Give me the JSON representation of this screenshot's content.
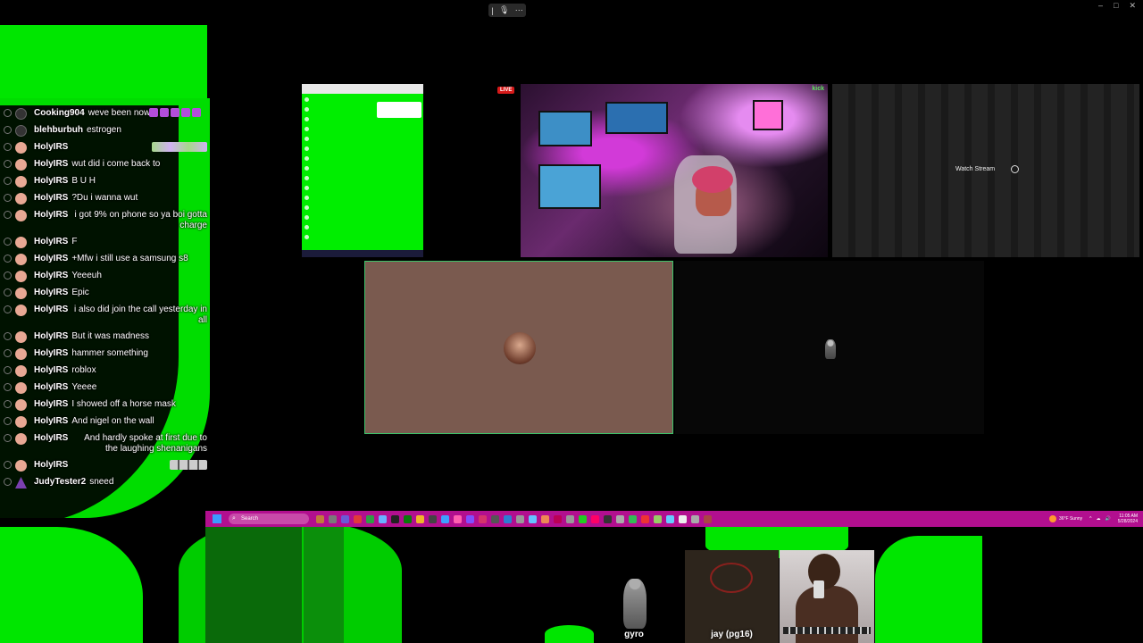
{
  "chat": {
    "messages": [
      {
        "user": "Cooking904",
        "text": "weve been now",
        "avatar": "dark"
      },
      {
        "user": "blehburbuh",
        "text": "estrogen",
        "avatar": "dark"
      },
      {
        "user": "HolyIRS",
        "text": "",
        "emote": true
      },
      {
        "user": "HolyIRS",
        "text": "wut did i come back to"
      },
      {
        "user": "HolyIRS",
        "text": "B U H"
      },
      {
        "user": "HolyIRS",
        "text": "?Du i wanna wut"
      },
      {
        "user": "HolyIRS",
        "text": "i got 9% on phone so ya boi gotta charge"
      },
      {
        "user": "HolyIRS",
        "text": "F"
      },
      {
        "user": "HolyIRS",
        "text": "+Mfw i still use a samsung s8"
      },
      {
        "user": "HolyIRS",
        "text": "Yeeeuh"
      },
      {
        "user": "HolyIRS",
        "text": "Epic"
      },
      {
        "user": "HolyIRS",
        "text": "i also did join the call yesterday in all"
      },
      {
        "user": "HolyIRS",
        "text": "But it was madness"
      },
      {
        "user": "HolyIRS",
        "text": "hammer something"
      },
      {
        "user": "HolyIRS",
        "text": "roblox"
      },
      {
        "user": "HolyIRS",
        "text": "Yeeee"
      },
      {
        "user": "HolyIRS",
        "text": "I showed off a horse mask"
      },
      {
        "user": "HolyIRS",
        "text": "And nigel on the wall"
      },
      {
        "user": "HolyIRS",
        "text": "And hardly spoke at first due to the laughing shenanigans"
      },
      {
        "user": "HolyIRS",
        "text": "",
        "emote_small": true
      },
      {
        "user": "JudyTester2",
        "text": "sneed",
        "avatar": "purple"
      }
    ]
  },
  "tiles": {
    "live_label": "LIVE",
    "stream_tag": "kick",
    "watch_stream_label": "Watch Stream"
  },
  "taskbar": {
    "search_placeholder": "Search",
    "weather": "36°F Sunny",
    "time": "11:05 AM",
    "date": "5/28/2024"
  },
  "participants": [
    {
      "name": "gyro"
    },
    {
      "name": "jay (pg16)"
    }
  ],
  "colors": {
    "green_screen": "#00e600",
    "taskbar": "#b20f8f",
    "active_tile_border": "#3cc46a",
    "live_badge": "#d61a1a"
  }
}
